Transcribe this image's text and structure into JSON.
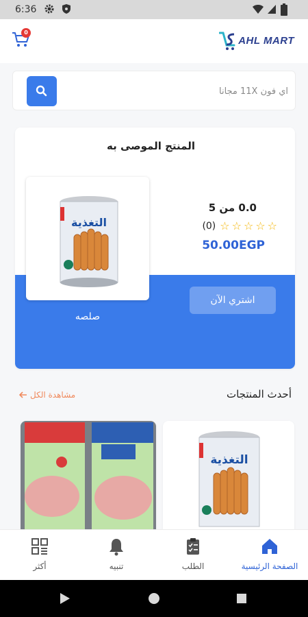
{
  "status_bar": {
    "time": "6:36"
  },
  "header": {
    "cart_badge": "0",
    "logo_text": "AHL MART"
  },
  "search": {
    "placeholder": "اي فون 11X مجانا"
  },
  "recommended": {
    "title": "المنتج الموصى به",
    "product_name": "صلصه",
    "rating_text": "0.0 من 5",
    "rating_value": 0,
    "rating_max": 5,
    "review_count": "(0)",
    "price": "50.00EGP",
    "buy_label": "اشتري الآن"
  },
  "latest": {
    "title": "أحدث المنتجات",
    "view_all": "مشاهدة الكل"
  },
  "bottom_nav": [
    {
      "label": "الصفحة الرئيسية",
      "icon": "home-icon",
      "active": true
    },
    {
      "label": "الطلب",
      "icon": "clipboard-icon",
      "active": false
    },
    {
      "label": "تنبيه",
      "icon": "bell-icon",
      "active": false
    },
    {
      "label": "أكثر",
      "icon": "grid-menu-icon",
      "active": false
    }
  ],
  "colors": {
    "primary": "#3a7bea",
    "price": "#2f63d6",
    "accent": "#f08a5d",
    "star": "#f4b400",
    "badge": "#e53935"
  }
}
